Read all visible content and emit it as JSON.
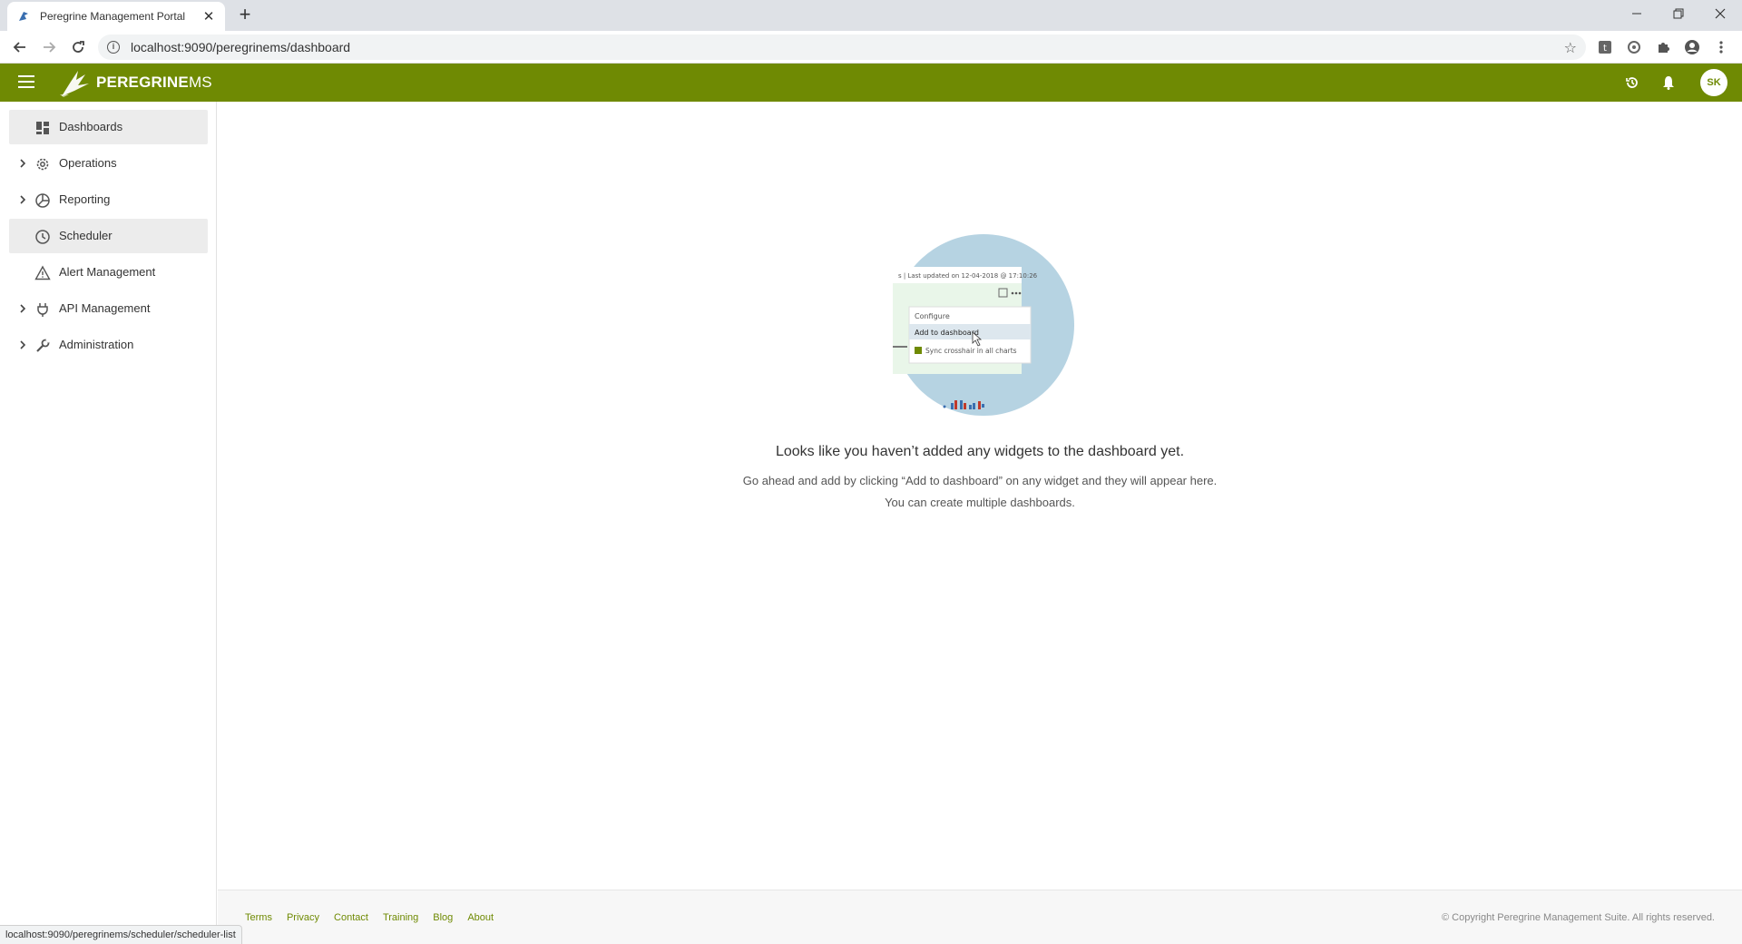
{
  "browser": {
    "tab_title": "Peregrine Management Portal",
    "url": "localhost:9090/peregrinems/dashboard",
    "status_url": "localhost:9090/peregrinems/scheduler/scheduler-list"
  },
  "app": {
    "brand_bold": "PEREGRINE",
    "brand_light": "MS",
    "user_initials": "SK",
    "accent_color": "#6f8a03"
  },
  "sidebar": {
    "items": [
      {
        "label": "Dashboards",
        "icon": "dashboard-icon"
      },
      {
        "label": "Operations",
        "icon": "gear-icon"
      },
      {
        "label": "Reporting",
        "icon": "pie-chart-icon"
      },
      {
        "label": "Scheduler",
        "icon": "clock-icon"
      },
      {
        "label": "Alert Management",
        "icon": "warning-icon"
      },
      {
        "label": "API Management",
        "icon": "plug-icon"
      },
      {
        "label": "Administration",
        "icon": "wrench-icon"
      }
    ]
  },
  "main": {
    "illus_header": "s | Last updated on 12-04-2018 @ 17:10:26",
    "illus_menu": [
      "Configure",
      "Add to dashboard",
      "Sync crosshair in all charts"
    ],
    "empty_title": "Looks like you haven’t added any widgets to the dashboard yet.",
    "empty_line1": "Go ahead and add by clicking “Add to dashboard” on any widget and they will appear here.",
    "empty_line2": "You can create multiple dashboards."
  },
  "footer": {
    "links": [
      "Terms",
      "Privacy",
      "Contact",
      "Training",
      "Blog",
      "About"
    ],
    "copyright": "© Copyright Peregrine Management Suite. All rights reserved."
  }
}
